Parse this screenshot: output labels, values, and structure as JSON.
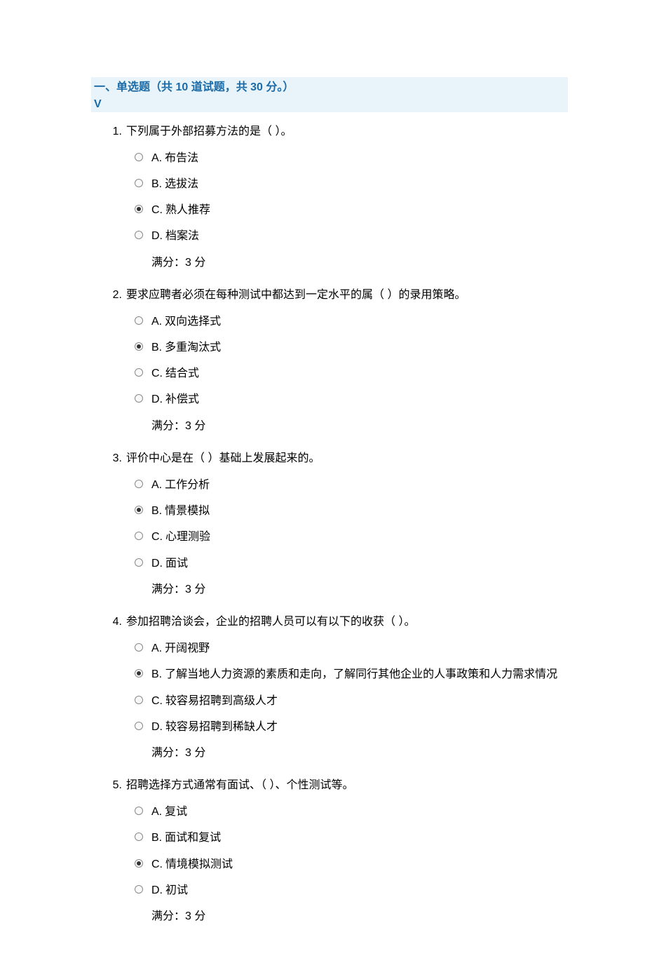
{
  "header": {
    "title": "一、单选题（共 10 道试题，共 30 分。）",
    "mark": "V"
  },
  "questions": [
    {
      "number": "1.",
      "stem": "下列属于外部招募方法的是（ ）。",
      "options": [
        {
          "letter": "A.",
          "text": "布告法",
          "selected": false
        },
        {
          "letter": "B.",
          "text": "选拔法",
          "selected": false
        },
        {
          "letter": "C.",
          "text": "熟人推荐",
          "selected": true
        },
        {
          "letter": "D.",
          "text": "档案法",
          "selected": false
        }
      ],
      "score": "满分：3 分"
    },
    {
      "number": "2.",
      "stem": "要求应聘者必须在每种测试中都达到一定水平的属（ ）的录用策略。",
      "options": [
        {
          "letter": "A.",
          "text": "双向选择式",
          "selected": false
        },
        {
          "letter": "B.",
          "text": "多重淘汰式",
          "selected": true
        },
        {
          "letter": "C.",
          "text": "结合式",
          "selected": false
        },
        {
          "letter": "D.",
          "text": "补偿式",
          "selected": false
        }
      ],
      "score": "满分：3 分"
    },
    {
      "number": "3.",
      "stem": "评价中心是在（ ）基础上发展起来的。",
      "options": [
        {
          "letter": "A.",
          "text": "工作分析",
          "selected": false
        },
        {
          "letter": "B.",
          "text": "情景模拟",
          "selected": true
        },
        {
          "letter": "C.",
          "text": "心理测验",
          "selected": false
        },
        {
          "letter": "D.",
          "text": "面试",
          "selected": false
        }
      ],
      "score": "满分：3 分"
    },
    {
      "number": "4.",
      "stem": "参加招聘洽谈会，企业的招聘人员可以有以下的收获（ ）。",
      "options": [
        {
          "letter": "A.",
          "text": "开阔视野",
          "selected": false
        },
        {
          "letter": "B.",
          "text": "了解当地人力资源的素质和走向，了解同行其他企业的人事政策和人力需求情况",
          "selected": true
        },
        {
          "letter": "C.",
          "text": "较容易招聘到高级人才",
          "selected": false
        },
        {
          "letter": "D.",
          "text": "较容易招聘到稀缺人才",
          "selected": false
        }
      ],
      "score": "满分：3 分"
    },
    {
      "number": "5.",
      "stem": "招聘选择方式通常有面试、（ ）、个性测试等。",
      "options": [
        {
          "letter": "A.",
          "text": "复试",
          "selected": false
        },
        {
          "letter": "B.",
          "text": "面试和复试",
          "selected": false
        },
        {
          "letter": "C.",
          "text": "情境模拟测试",
          "selected": true
        },
        {
          "letter": "D.",
          "text": "初试",
          "selected": false
        }
      ],
      "score": "满分：3 分"
    }
  ]
}
